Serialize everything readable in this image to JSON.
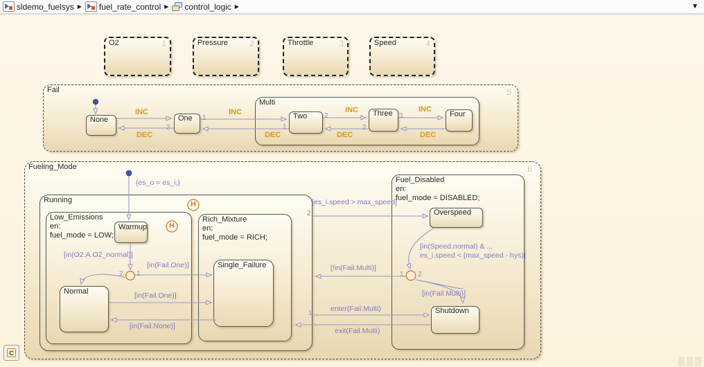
{
  "icons": {
    "breadcrumb_sep": "▶",
    "dropdown": "▼"
  },
  "breadcrumb": {
    "item1": "sldemo_fuelsys",
    "item2": "fuel_rate_control",
    "item3": "control_logic"
  },
  "badge": {
    "action_language": "C"
  },
  "subcharts": {
    "o2": {
      "name": "O2",
      "num": "1"
    },
    "pressure": {
      "name": "Pressure",
      "num": "2"
    },
    "throttle": {
      "name": "Throttle",
      "num": "3"
    },
    "speed": {
      "name": "Speed",
      "num": "4"
    }
  },
  "fail": {
    "name": "Fail",
    "num": "5",
    "multi": "Multi",
    "none": "None",
    "one": "One",
    "two": "Two",
    "three": "Three",
    "four": "Four",
    "inc": "INC",
    "dec": "DEC"
  },
  "fueling": {
    "name": "Fueling_Mode",
    "num": "6",
    "init_action": "{es_o = es_i;}",
    "running": {
      "name": "Running"
    },
    "low_emissions": {
      "name": "Low_Emissions",
      "en": "en:",
      "action": "fuel_mode = LOW;",
      "warmup": "Warmup",
      "normal": "Normal"
    },
    "rich_mixture": {
      "name": "Rich_Mixture",
      "en": "en:",
      "action": "fuel_mode = RICH;",
      "single_failure": "Single_Failure"
    },
    "fuel_disabled": {
      "name": "Fuel_Disabled",
      "en": "en:",
      "action": "fuel_mode = DISABLED;",
      "overspeed": "Overspeed",
      "shutdown": "Shutdown"
    },
    "history": "H",
    "t": {
      "in_o2_normal": "[in(O2.A.O2_normal)]",
      "in_fail_one": "[in(Fail.One)]",
      "in_fail_none": "[in(Fail.None)]",
      "speed_gt": "[es_i.speed > max_speed]",
      "not_in_fail_multi": "[!in(Fail.Multi)]",
      "in_speed_normal": "[in(Speed.normal) & ...",
      "speed_lt": "es_i.speed < (max_speed - hys)]",
      "in_fail_multi": "[in(Fail.Multi)]",
      "enter_fail_multi": "enter(Fail.Multi)",
      "exit_fail_multi": "exit(Fail.Multi)"
    }
  },
  "nums": {
    "n1": "1",
    "n2": "2"
  }
}
